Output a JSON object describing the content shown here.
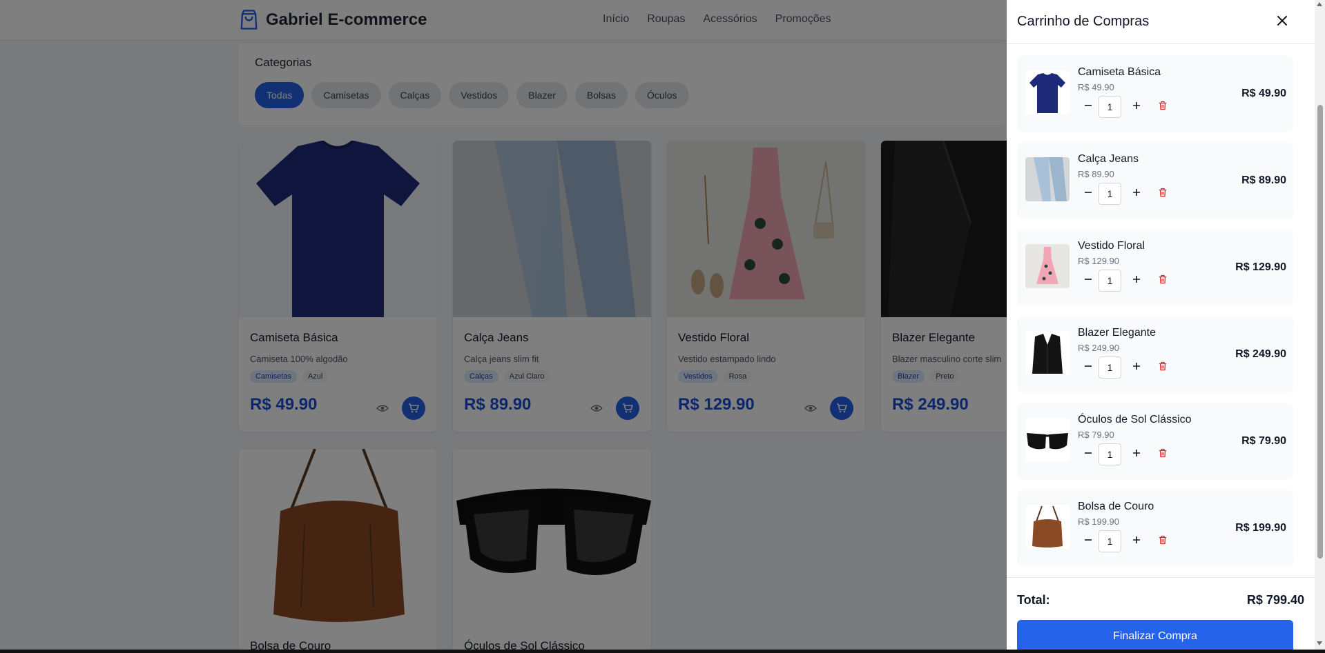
{
  "header": {
    "brand": "Gabriel E-commerce",
    "nav": [
      "Início",
      "Roupas",
      "Acessórios",
      "Promoções"
    ]
  },
  "categories": {
    "title": "Categorias",
    "chips": [
      "Todas",
      "Camisetas",
      "Calças",
      "Vestidos",
      "Blazer",
      "Bolsas",
      "Óculos"
    ],
    "active": "Todas"
  },
  "products": [
    {
      "name": "Camiseta Básica",
      "desc": "Camiseta 100% algodão",
      "category": "Camisetas",
      "color": "Azul",
      "price": "R$ 49.90"
    },
    {
      "name": "Calça Jeans",
      "desc": "Calça jeans slim fit",
      "category": "Calças",
      "color": "Azul Claro",
      "price": "R$ 89.90"
    },
    {
      "name": "Vestido Floral",
      "desc": "Vestido estampado lindo",
      "category": "Vestidos",
      "color": "Rosa",
      "price": "R$ 129.90"
    },
    {
      "name": "Blazer Elegante",
      "desc": "Blazer masculino corte slim",
      "category": "Blazer",
      "color": "Preto",
      "price": "R$ 249.90"
    },
    {
      "name": "Bolsa de Couro"
    },
    {
      "name": "Óculos de Sol Clássico"
    }
  ],
  "cart": {
    "title": "Carrinho de Compras",
    "items": [
      {
        "name": "Camiseta Básica",
        "unit": "R$ 49.90",
        "qty": "1",
        "total": "R$ 49.90"
      },
      {
        "name": "Calça Jeans",
        "unit": "R$ 89.90",
        "qty": "1",
        "total": "R$ 89.90"
      },
      {
        "name": "Vestido Floral",
        "unit": "R$ 129.90",
        "qty": "1",
        "total": "R$ 129.90"
      },
      {
        "name": "Blazer Elegante",
        "unit": "R$ 249.90",
        "qty": "1",
        "total": "R$ 249.90"
      },
      {
        "name": "Óculos de Sol Clássico",
        "unit": "R$ 79.90",
        "qty": "1",
        "total": "R$ 79.90"
      },
      {
        "name": "Bolsa de Couro",
        "unit": "R$ 199.90",
        "qty": "1",
        "total": "R$ 199.90"
      }
    ],
    "total_label": "Total:",
    "total_value": "R$ 799.40",
    "checkout": "Finalizar Compra"
  },
  "icons": {
    "brand": "shopping-bag-icon",
    "view": "eye-icon",
    "add_to_cart": "cart-icon",
    "close": "close-icon",
    "decrease": "minus-icon",
    "increase": "plus-icon",
    "remove": "trash-icon"
  },
  "colors": {
    "accent": "#2563eb",
    "price": "#1d4ed8",
    "danger": "#dc2626",
    "overlay": "rgba(0,0,0,0.5)"
  }
}
